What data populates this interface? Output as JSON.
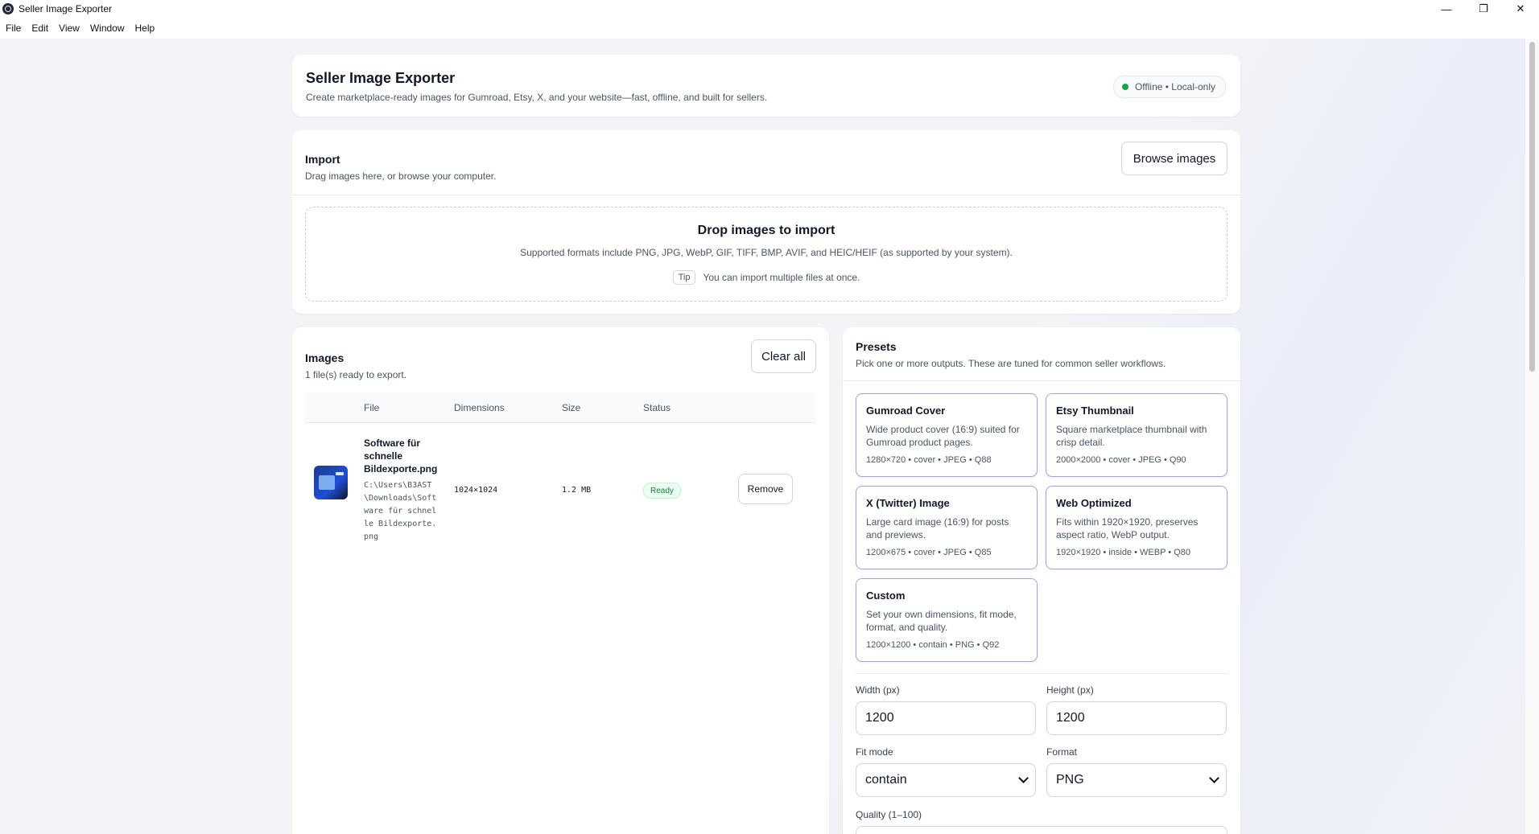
{
  "window": {
    "title": "Seller Image Exporter",
    "controls": {
      "minimize": "—",
      "maximize": "❐",
      "close": "✕"
    }
  },
  "menu": [
    "File",
    "Edit",
    "View",
    "Window",
    "Help"
  ],
  "header": {
    "title": "Seller Image Exporter",
    "subtitle": "Create marketplace-ready images for Gumroad, Etsy, X, and your website—fast, offline, and built for sellers.",
    "badge": "Offline • Local-only",
    "badge_color": "#16a34a"
  },
  "import": {
    "title": "Import",
    "subtitle": "Drag images here, or browse your computer.",
    "browse_label": "Browse images",
    "drop_title": "Drop images to import",
    "drop_sub": "Supported formats include PNG, JPG, WebP, GIF, TIFF, BMP, AVIF, and HEIC/HEIF (as supported by your system).",
    "tip_label": "Tip",
    "tip_text": "You can import multiple files at once."
  },
  "images": {
    "title": "Images",
    "subtitle": "1 file(s) ready to export.",
    "clear_label": "Clear all",
    "columns": [
      "File",
      "Dimensions",
      "Size",
      "Status"
    ],
    "rows": [
      {
        "name": "Software für schnelle Bildexporte.png",
        "path": "C:\\Users\\B3AST\\Downloads\\Software für schnelle Bildexporte.png",
        "dimensions": "1024×1024",
        "size": "1.2 MB",
        "status": "Ready",
        "remove_label": "Remove"
      }
    ]
  },
  "presets": {
    "title": "Presets",
    "subtitle": "Pick one or more outputs. These are tuned for common seller workflows.",
    "accent": "#a5a1e6",
    "items": [
      {
        "title": "Gumroad Cover",
        "desc": "Wide product cover (16:9) suited for Gumroad product pages.",
        "meta": "1280×720 • cover • JPEG • Q88"
      },
      {
        "title": "Etsy Thumbnail",
        "desc": "Square marketplace thumbnail with crisp detail.",
        "meta": "2000×2000 • cover • JPEG • Q90"
      },
      {
        "title": "X (Twitter) Image",
        "desc": "Large card image (16:9) for posts and previews.",
        "meta": "1200×675 • cover • JPEG • Q85"
      },
      {
        "title": "Web Optimized",
        "desc": "Fits within 1920×1920, preserves aspect ratio, WebP output.",
        "meta": "1920×1920 • inside • WEBP • Q80"
      },
      {
        "title": "Custom",
        "desc": "Set your own dimensions, fit mode, format, and quality.",
        "meta": "1200×1200 • contain • PNG • Q92"
      }
    ],
    "width_label": "Width (px)",
    "width_value": "1200",
    "height_label": "Height (px)",
    "height_value": "1200",
    "fit_label": "Fit mode",
    "fit_value": "contain",
    "format_label": "Format",
    "format_value": "PNG",
    "quality_label": "Quality (1–100)"
  }
}
